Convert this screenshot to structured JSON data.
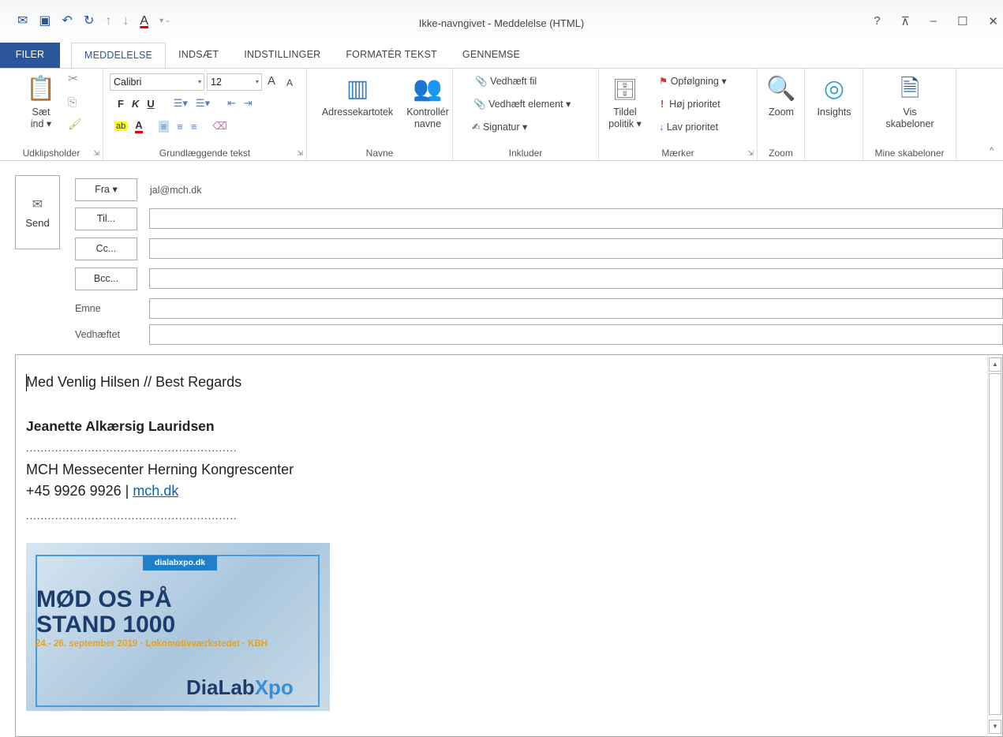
{
  "window": {
    "title": "Ikke-navngivet - Meddelelse (HTML)",
    "qat": [
      "mail-icon",
      "save-icon",
      "undo-icon",
      "redo-icon",
      "up-arrow-icon",
      "down-arrow-icon",
      "font-color-icon",
      "customize-icon"
    ],
    "controls": {
      "help": "?",
      "ribbon": "⊼",
      "minimize": "–",
      "maximize": "☐",
      "close": "✕"
    }
  },
  "tabs": [
    "FILER",
    "MEDDELELSE",
    "INDSÆT",
    "INDSTILLINGER",
    "FORMATÉR TEKST",
    "GENNEMSE"
  ],
  "ribbon": {
    "clipboard": {
      "label": "Udklipsholder",
      "paste_line1": "Sæt",
      "paste_line2": "ind ▾"
    },
    "basic_text": {
      "label": "Grundlæggende tekst",
      "font": "Calibri",
      "size": "12",
      "grow": "A",
      "shrink": "A",
      "bold": "F",
      "italic": "K",
      "underline": "U"
    },
    "names": {
      "label": "Navne",
      "address_book": "Adressekartotek",
      "check_names_line1": "Kontrollér",
      "check_names_line2": "navne"
    },
    "include": {
      "label": "Inkluder",
      "attach_file": "Vedhæft fil",
      "attach_item": "Vedhæft element ▾",
      "signature": "Signatur ▾"
    },
    "tags": {
      "label": "Mærker",
      "assign_line1": "Tildel",
      "assign_line2": "politik ▾",
      "followup": "Opfølgning ▾",
      "high": "Høj prioritet",
      "low": "Lav prioritet"
    },
    "zoom": {
      "label": "Zoom",
      "button": "Zoom"
    },
    "insights": {
      "button": "Insights"
    },
    "templates": {
      "label": "Mine skabeloner",
      "line1": "Vis",
      "line2": "skabeloner"
    }
  },
  "header": {
    "send": "Send",
    "from_btn": "Fra ▾",
    "from_value": "jal@mch.dk",
    "to_btn": "Til...",
    "cc_btn": "Cc...",
    "bcc_btn": "Bcc...",
    "subject_label": "Emne",
    "attached_label": "Vedhæftet"
  },
  "body": {
    "greeting": "Med Venlig Hilsen // Best Regards",
    "name": "Jeanette Alkærsig Lauridsen",
    "dots": "..........................................................",
    "company": "MCH Messecenter Herning Kongrescenter",
    "phone": "+45 9926 9926 | ",
    "link": "mch.dk",
    "banner": {
      "url": "dialabxpo.dk",
      "line1": "MØD OS PÅ",
      "line2": "STAND 1000",
      "date": "24.- 26. september 2019 · Lokomotivværkstedet · KBH",
      "logo_a": "DiaLab",
      "logo_b": "Xpo"
    }
  }
}
